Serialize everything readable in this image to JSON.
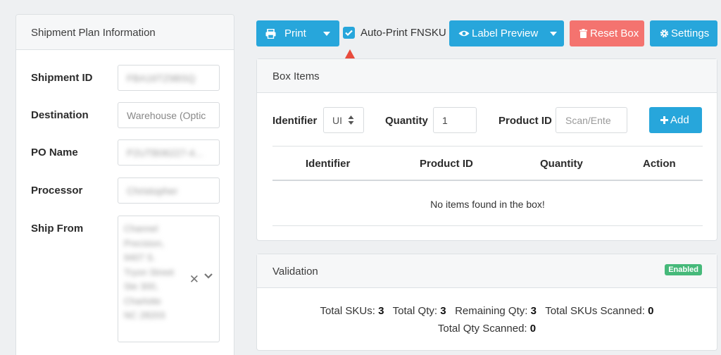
{
  "shipment_panel": {
    "title": "Shipment Plan Information",
    "fields": {
      "shipment_id": {
        "label": "Shipment ID",
        "value": "FBA16TZ9BSQ"
      },
      "destination": {
        "label": "Destination",
        "placeholder": "Warehouse (Optic"
      },
      "po_name": {
        "label": "PO Name",
        "value": "P2UTB06227-4..."
      },
      "processor": {
        "label": "Processor",
        "value": "Christopher"
      },
      "ship_from": {
        "label": "Ship From",
        "lines": [
          "Channel",
          "Precision,",
          "9407 S.",
          "Tryon Street",
          "Ste 300,",
          "Charlotte",
          "NC 28203"
        ]
      }
    }
  },
  "toolbar": {
    "print_label": "Print",
    "auto_print_label": "Auto-Print FNSKU",
    "auto_print_checked": true,
    "label_preview_label": "Label Preview",
    "reset_box_label": "Reset Box",
    "settings_label": "Settings"
  },
  "box_items": {
    "title": "Box Items",
    "identifier_label": "Identifier",
    "identifier_value": "UI",
    "quantity_label": "Quantity",
    "quantity_value": "1",
    "product_id_label": "Product ID",
    "product_id_placeholder": "Scan/Ente",
    "add_label": "Add",
    "columns": [
      "Identifier",
      "Product ID",
      "Quantity",
      "Action"
    ],
    "empty_message": "No items found in the box!"
  },
  "validation": {
    "title": "Validation",
    "status": "Enabled",
    "total_skus_label": "Total SKUs:",
    "total_skus": "3",
    "total_qty_label": "Total Qty:",
    "total_qty": "3",
    "remaining_qty_label": "Remaining Qty:",
    "remaining_qty": "3",
    "total_skus_scanned_label": "Total SKUs Scanned:",
    "total_skus_scanned": "0",
    "total_qty_scanned_label": "Total Qty Scanned:",
    "total_qty_scanned": "0"
  },
  "colors": {
    "primary": "#27a6db",
    "danger": "#f4736f",
    "success": "#46b97a",
    "arrow": "#e84b3c"
  }
}
